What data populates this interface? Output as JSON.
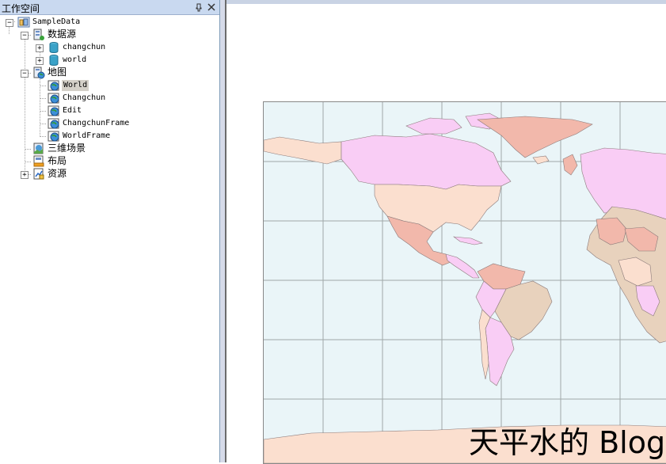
{
  "panel": {
    "title": "工作空间",
    "pin_glyph": "ᵖ",
    "close_glyph": "✕"
  },
  "tree": {
    "root": {
      "label": "SampleData",
      "icon": "workspace-icon"
    },
    "datasources": {
      "label": "数据源",
      "icon": "datasources-icon",
      "items": [
        {
          "label": "changchun",
          "icon": "datasource-db-icon"
        },
        {
          "label": "world",
          "icon": "datasource-db-icon"
        }
      ]
    },
    "maps": {
      "label": "地图",
      "icon": "maps-icon",
      "items": [
        {
          "label": "World",
          "icon": "map-globe-icon",
          "selected": true
        },
        {
          "label": "Changchun",
          "icon": "map-globe-icon"
        },
        {
          "label": "Edit",
          "icon": "map-globe-icon"
        },
        {
          "label": "ChangchunFrame",
          "icon": "map-globe-icon"
        },
        {
          "label": "WorldFrame",
          "icon": "map-globe-icon"
        }
      ]
    },
    "scenes": {
      "label": "三维场景",
      "icon": "scene-icon"
    },
    "layouts": {
      "label": "布局",
      "icon": "layout-icon"
    },
    "resources": {
      "label": "资源",
      "icon": "resources-icon"
    }
  },
  "map_view": {
    "watermark": "天平水的 Blog",
    "ocean_color": "#eaf5f8",
    "graticule_color": "#a0a8a8",
    "land_colors": [
      "#f9cdf5",
      "#fbdfcf",
      "#e8d2bd",
      "#f2b8ab"
    ]
  }
}
